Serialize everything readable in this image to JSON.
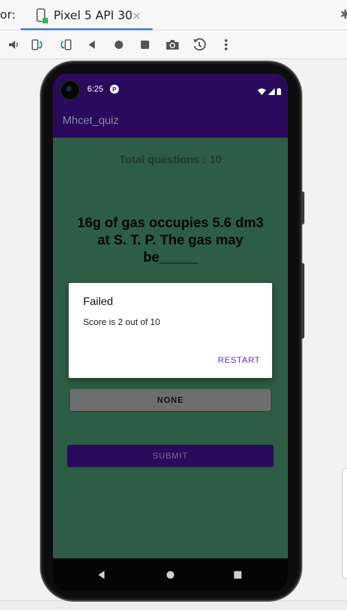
{
  "ide": {
    "tab_prefix": "or:",
    "device_tab": "Pixel 5 API 30",
    "close_glyph": "×",
    "toolbar_icons": [
      "volume-icon",
      "rotate-left-icon",
      "rotate-right-icon",
      "back-triangle-icon",
      "home-circle-icon",
      "overview-square-icon",
      "camera-icon",
      "snapshot-restore-icon",
      "more-vertical-icon"
    ]
  },
  "status": {
    "time": "6:25",
    "p_badge": "P"
  },
  "app": {
    "title": "Mhcet_quiz",
    "total_questions": "Total questions : 10",
    "question": "16g of gas occupies 5.6 dm3 at S. T. P. The gas may be_____",
    "option_label": "NONE",
    "submit_label": "SUBMIT"
  },
  "dialog": {
    "title": "Failed",
    "message": "Score is 2 out of 10",
    "button": "RESTART"
  },
  "colors": {
    "primary": "#2a0a5c",
    "background": "#2e5d45",
    "accent": "#5a1fd1"
  }
}
